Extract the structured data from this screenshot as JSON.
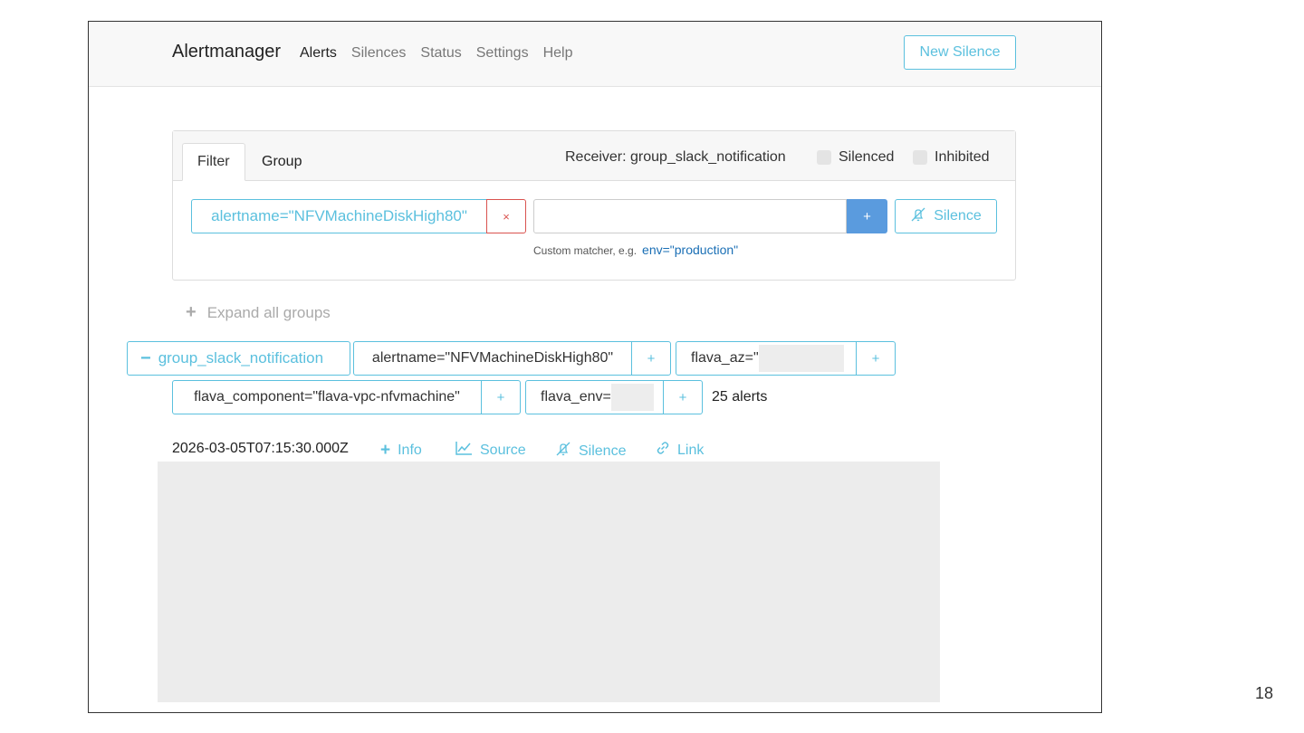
{
  "navbar": {
    "brand": "Alertmanager",
    "items": [
      "Alerts",
      "Silences",
      "Status",
      "Settings",
      "Help"
    ],
    "new_silence": "New Silence"
  },
  "filter_card": {
    "tabs": [
      "Filter",
      "Group"
    ],
    "receiver": "Receiver: group_slack_notification",
    "silenced": "Silenced",
    "inhibited": "Inhibited",
    "matcher": "alertname=\"NFVMachineDiskHigh80\"",
    "remove": "×",
    "custom_input_value": "",
    "add": "+",
    "silence": "Silence",
    "hint_text": "Custom matcher, e.g.",
    "hint_code": "env=\"production\""
  },
  "expand_all": "Expand all groups",
  "group": {
    "toggle_label": "group_slack_notification",
    "labels": [
      {
        "text": "alertname=\"NFVMachineDiskHigh80\""
      },
      {
        "text": "flava_az=\""
      },
      {
        "text": "flava_component=\"flava-vpc-nfvmachine\""
      },
      {
        "text": "flava_env="
      }
    ],
    "plus": "+",
    "count": "25 alerts"
  },
  "alert": {
    "timestamp": "2026-03-05T07:15:30.000Z",
    "info": "Info",
    "source": "Source",
    "silence": "Silence",
    "link": "Link"
  },
  "page_number": "18",
  "colors": {
    "accent": "#5bc0de",
    "danger": "#d9534f",
    "primary_button": "#5a9bde",
    "redaction": "#ededed"
  }
}
